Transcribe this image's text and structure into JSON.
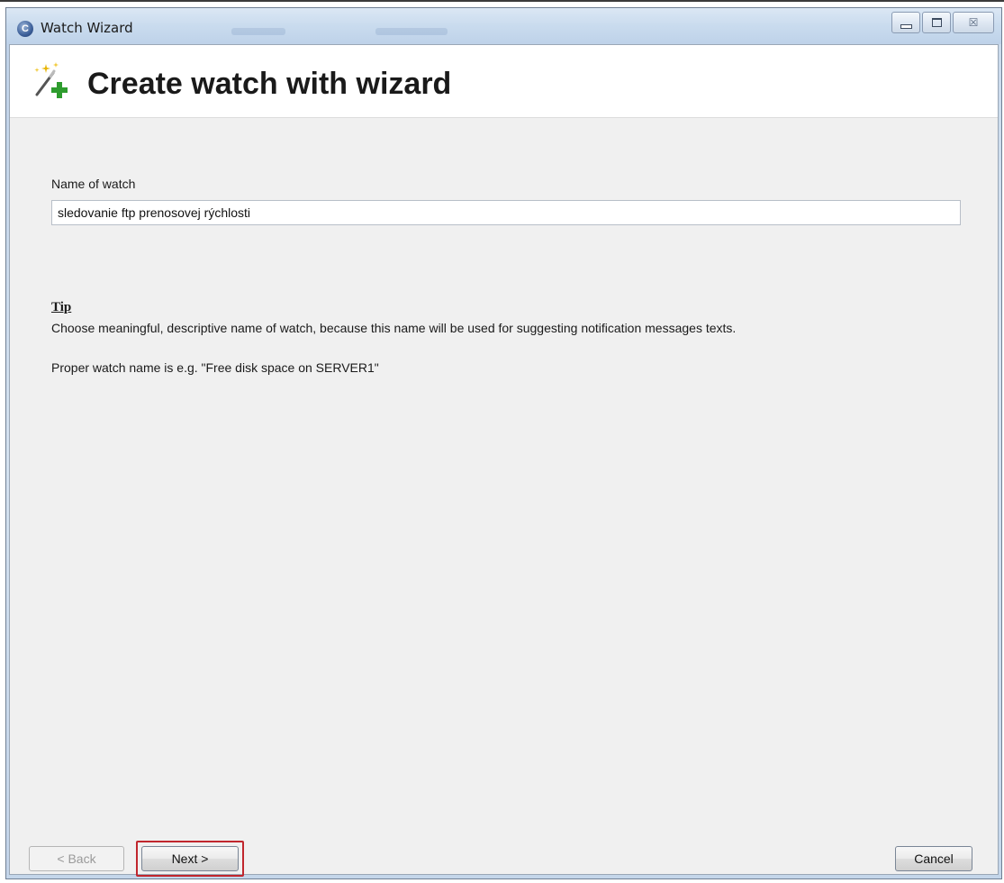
{
  "window": {
    "title": "Watch Wizard",
    "controls": {
      "minimize": "minimize-icon",
      "maximize": "maximize-icon",
      "close": "close-icon",
      "close_glyph": "☒"
    }
  },
  "header": {
    "title": "Create watch with wizard",
    "icon": "magic-wand-add-icon"
  },
  "form": {
    "name_label": "Name of watch",
    "name_value": "sledovanie ftp prenosovej rýchlosti"
  },
  "tip": {
    "heading": "Tip",
    "text": "Choose meaningful, descriptive name of watch, because this name will be used for suggesting notification messages texts.",
    "example": "Proper watch name is e.g. \"Free disk space on SERVER1\""
  },
  "buttons": {
    "back": "< Back",
    "next": "Next >",
    "cancel": "Cancel"
  },
  "colors": {
    "highlight_border": "#c0262d",
    "client_background": "#f0f0f0",
    "header_background": "#ffffff"
  }
}
